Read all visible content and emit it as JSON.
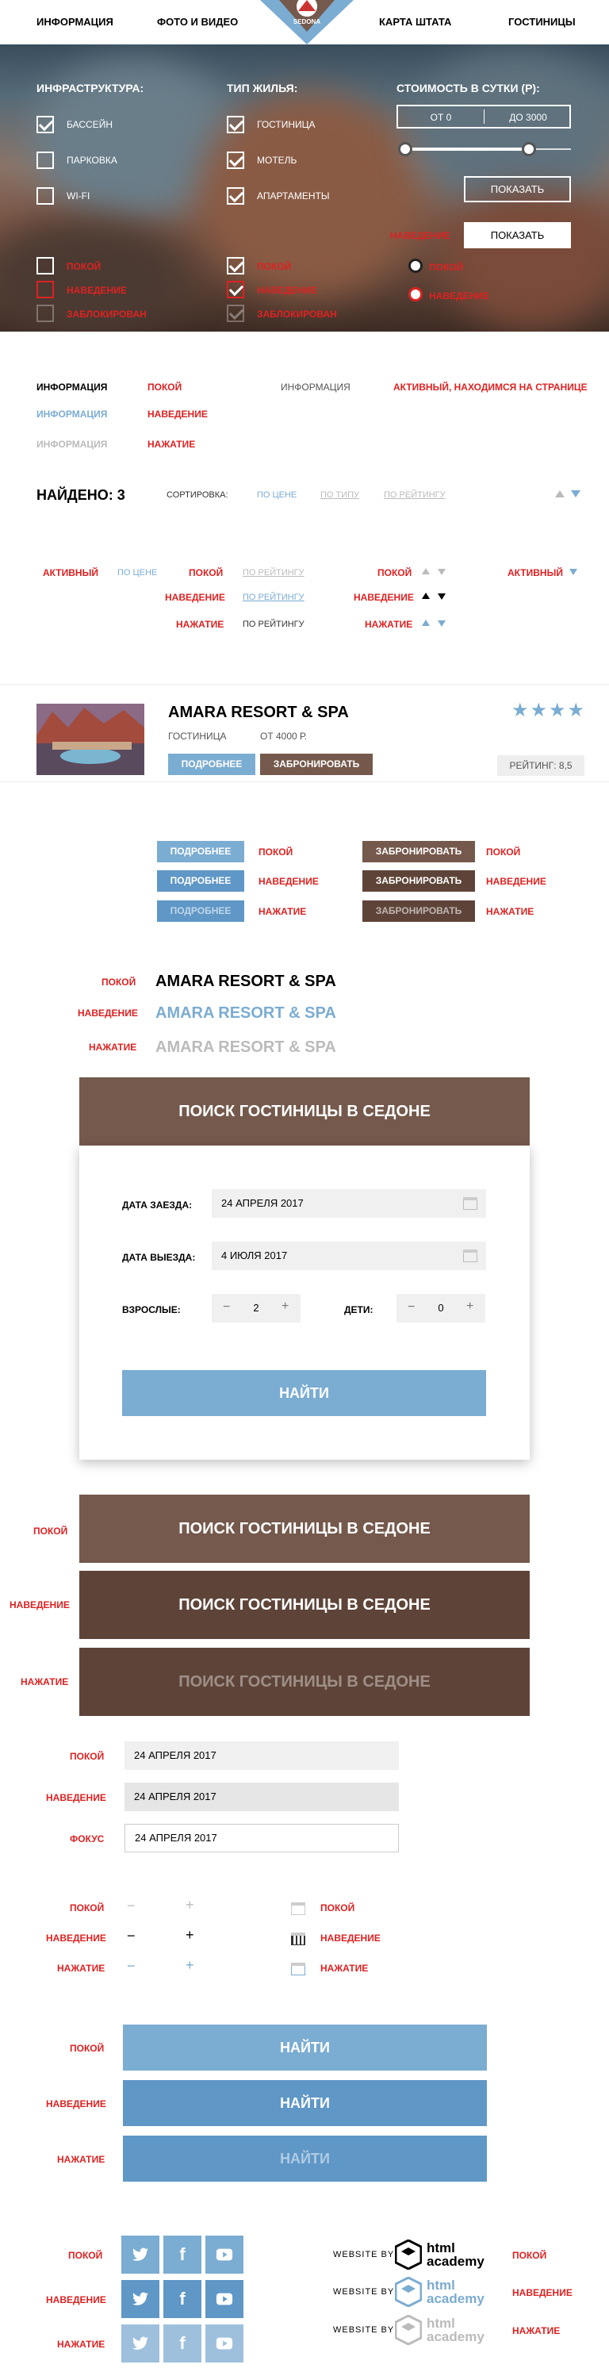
{
  "nav": {
    "item1": "Информация",
    "item2": "Фото и видео",
    "item3": "Карта штата",
    "item4": "Гостиницы",
    "logo_text": "Sedona"
  },
  "filters": {
    "infra_title": "Инфраструктура:",
    "infra": [
      "Бассейн",
      "Парковка",
      "Wi-Fi"
    ],
    "type_title": "Тип жилья:",
    "type": [
      "Гостиница",
      "Мотель",
      "Апартаменты"
    ],
    "price_title": "Стоимость в сутки (Р):",
    "price_from": "от 0",
    "price_to": "до 3000",
    "show": "Показать",
    "show_hover": "Показать",
    "hover_label": "Наведение"
  },
  "states": {
    "rest": "Покой",
    "hover": "Наведение",
    "press": "Нажатие",
    "blocked": "Заблокирован",
    "focus": "Фокус",
    "active": "Активный",
    "active_page": "Активный, находимся на странице",
    "info": "Информация"
  },
  "results": {
    "found": "Найдено: 3",
    "sort_label": "Сортировка:",
    "by_price": "По цене",
    "by_type": "По типу",
    "by_rating": "По рейтингу"
  },
  "hotel": {
    "name": "Amara Resort & Spa",
    "type": "Гостиница",
    "price": "от 4000 р.",
    "more": "Подробнее",
    "book": "Забронировать",
    "rating": "Рейтинг: 8,5",
    "stars": "★★★★"
  },
  "search": {
    "title": "Поиск гостиницы в Седоне",
    "checkin_label": "Дата заезда:",
    "checkin": "24 апреля 2017",
    "checkout_label": "Дата выезда:",
    "checkout": "4 июля 2017",
    "adults_label": "Взрослые:",
    "adults": "2",
    "children_label": "Дети:",
    "children": "0",
    "submit": "Найти",
    "minus": "−",
    "plus": "+"
  },
  "footer": {
    "website_by": "Website by",
    "academy_line1": "html",
    "academy_line2": "academy"
  },
  "colors": {
    "accent_blue": "#7bacd2",
    "brand_brown": "#74594c",
    "state_red": "#dd2222"
  }
}
